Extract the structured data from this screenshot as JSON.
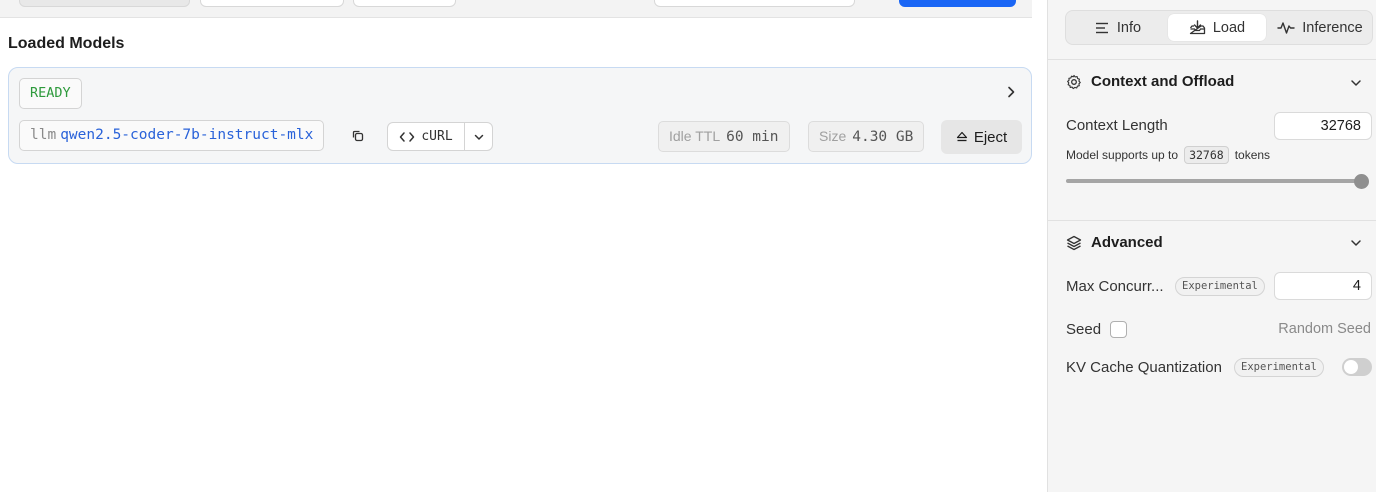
{
  "main": {
    "section_title": "Loaded Models",
    "model_card": {
      "status": "READY",
      "model_type": "llm",
      "model_name": "qwen2.5-coder-7b-instruct-mlx",
      "curl_label": "cURL",
      "idle_ttl_label": "Idle TTL",
      "idle_ttl_value": "60 min",
      "size_label": "Size",
      "size_value": "4.30 GB",
      "eject_label": "Eject"
    }
  },
  "sidebar": {
    "tabs": [
      {
        "label": "Info",
        "icon": "menu-lines-icon"
      },
      {
        "label": "Load",
        "icon": "tray-download-icon"
      },
      {
        "label": "Inference",
        "icon": "activity-icon"
      }
    ],
    "active_tab": "Load",
    "context_section": {
      "title": "Context and Offload",
      "context_length_label": "Context Length",
      "context_length_value": "32768",
      "supports_prefix": "Model supports up to",
      "supports_value": "32768",
      "supports_suffix": "tokens",
      "slider_fraction": 1.0
    },
    "advanced_section": {
      "title": "Advanced",
      "max_concurrent_label": "Max Concurr...",
      "max_concurrent_badge": "Experimental",
      "max_concurrent_value": "4",
      "seed_label": "Seed",
      "seed_checked": false,
      "random_seed_label": "Random Seed",
      "kv_cache_label": "KV Cache Quantization",
      "kv_cache_badge": "Experimental",
      "kv_cache_enabled": false
    }
  },
  "colors": {
    "accent": "#1a66f5",
    "ready_green": "#2e9a3c",
    "model_name_blue": "#2962d9",
    "card_border": "#c7daf2"
  }
}
